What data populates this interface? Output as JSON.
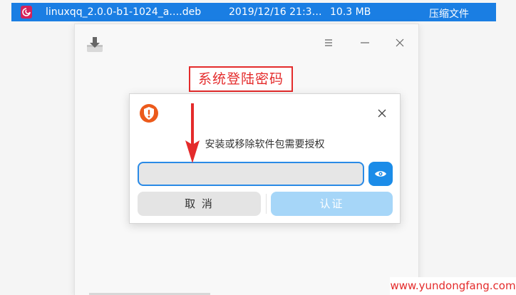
{
  "file_row": {
    "name": "linuxqq_2.0.0-b1-1024_a….deb",
    "date": "2019/12/16 21:3…",
    "size": "10.3 MB",
    "kind": "压缩文件"
  },
  "annotation": {
    "text": "系统登陆密码"
  },
  "dialog": {
    "message": "安装或移除软件包需要授权",
    "password_value": "",
    "cancel_label": "取 消",
    "confirm_label": "认证"
  },
  "colors": {
    "accent": "#1b8ce8",
    "selection": "#1a7ee3",
    "annotation_red": "#e42b2b",
    "shield_orange": "#ec5a1b"
  },
  "watermark": {
    "text": "www.yundongfang.com"
  },
  "icons": [
    "deb-package-icon",
    "download-icon",
    "menu-icon",
    "minimize-icon",
    "close-icon",
    "shield-icon",
    "eye-icon",
    "arrow-down-icon"
  ]
}
